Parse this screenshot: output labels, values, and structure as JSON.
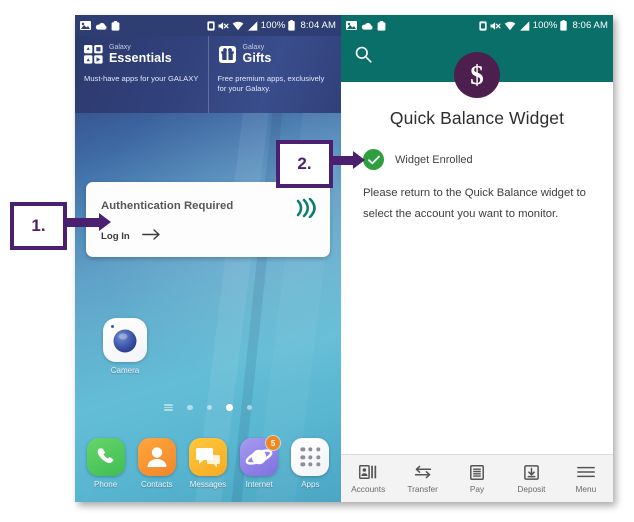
{
  "left_phone": {
    "status_bar": {
      "icons": [
        "image-icon",
        "cloud-icon",
        "clipboard-icon"
      ],
      "right_icons": [
        "sim-icon",
        "mute-icon",
        "wifi-icon",
        "signal-icon"
      ],
      "battery_percent": "100%",
      "time": "8:04 AM"
    },
    "galaxy_widget": {
      "left": {
        "brand": "Galaxy",
        "title": "Essentials",
        "description": "Must-have apps for your GALAXY",
        "icon": "galaxy-essentials-icon"
      },
      "right": {
        "brand": "Galaxy",
        "title": "Gifts",
        "description": "Free premium apps, exclusively for your Galaxy.",
        "icon": "galaxy-gifts-icon"
      }
    },
    "auth_card": {
      "title": "Authentication Required",
      "login_label": "Log In",
      "arrow_icon": "arrow-right-icon",
      "logo_icon": "contactless-nfc-icon",
      "logo_color": "#0f7d72"
    },
    "home_apps": [
      {
        "label": "Camera",
        "icon": "camera-icon"
      }
    ],
    "page_dots": {
      "count": 4,
      "active_index": 3,
      "home_indicator": "home-pages-icon"
    },
    "dock": [
      {
        "label": "Phone",
        "icon": "phone-icon",
        "color": "#3fbe52",
        "badge": ""
      },
      {
        "label": "Contacts",
        "icon": "contact-person-icon",
        "color": "#f2862a",
        "badge": ""
      },
      {
        "label": "Messages",
        "icon": "speech-bubble-icon",
        "color": "#f5ab23",
        "badge": ""
      },
      {
        "label": "Internet",
        "icon": "internet-planet-icon",
        "color": "#7f6fe0",
        "badge": "5"
      },
      {
        "label": "Apps",
        "icon": "apps-grid-icon",
        "color": "#ffffff",
        "badge": ""
      }
    ]
  },
  "right_phone": {
    "status_bar": {
      "icons": [
        "image-icon",
        "cloud-icon",
        "clipboard-icon"
      ],
      "right_icons": [
        "sim-icon",
        "mute-icon",
        "wifi-icon",
        "signal-icon"
      ],
      "battery_percent": "100%",
      "time": "8:06 AM"
    },
    "header": {
      "search_icon": "search-icon",
      "background_color": "#0a6f69",
      "avatar_symbol": "$",
      "avatar_color": "#4d1f4f"
    },
    "title": "Quick Balance Widget",
    "status": {
      "icon": "check-circle-icon",
      "icon_color": "#2e9e3f",
      "text": "Widget Enrolled"
    },
    "body_text": "Please return to the Quick Balance widget to select the account you want to monitor.",
    "bottom_nav": [
      {
        "label": "Accounts",
        "icon": "accounts-card-icon"
      },
      {
        "label": "Transfer",
        "icon": "transfer-arrows-icon"
      },
      {
        "label": "Pay",
        "icon": "pay-list-icon"
      },
      {
        "label": "Deposit",
        "icon": "deposit-download-icon"
      },
      {
        "label": "Menu",
        "icon": "hamburger-menu-icon"
      }
    ]
  },
  "callouts": [
    {
      "label": "1.",
      "color": "#4b2070"
    },
    {
      "label": "2.",
      "color": "#4b2070"
    }
  ]
}
